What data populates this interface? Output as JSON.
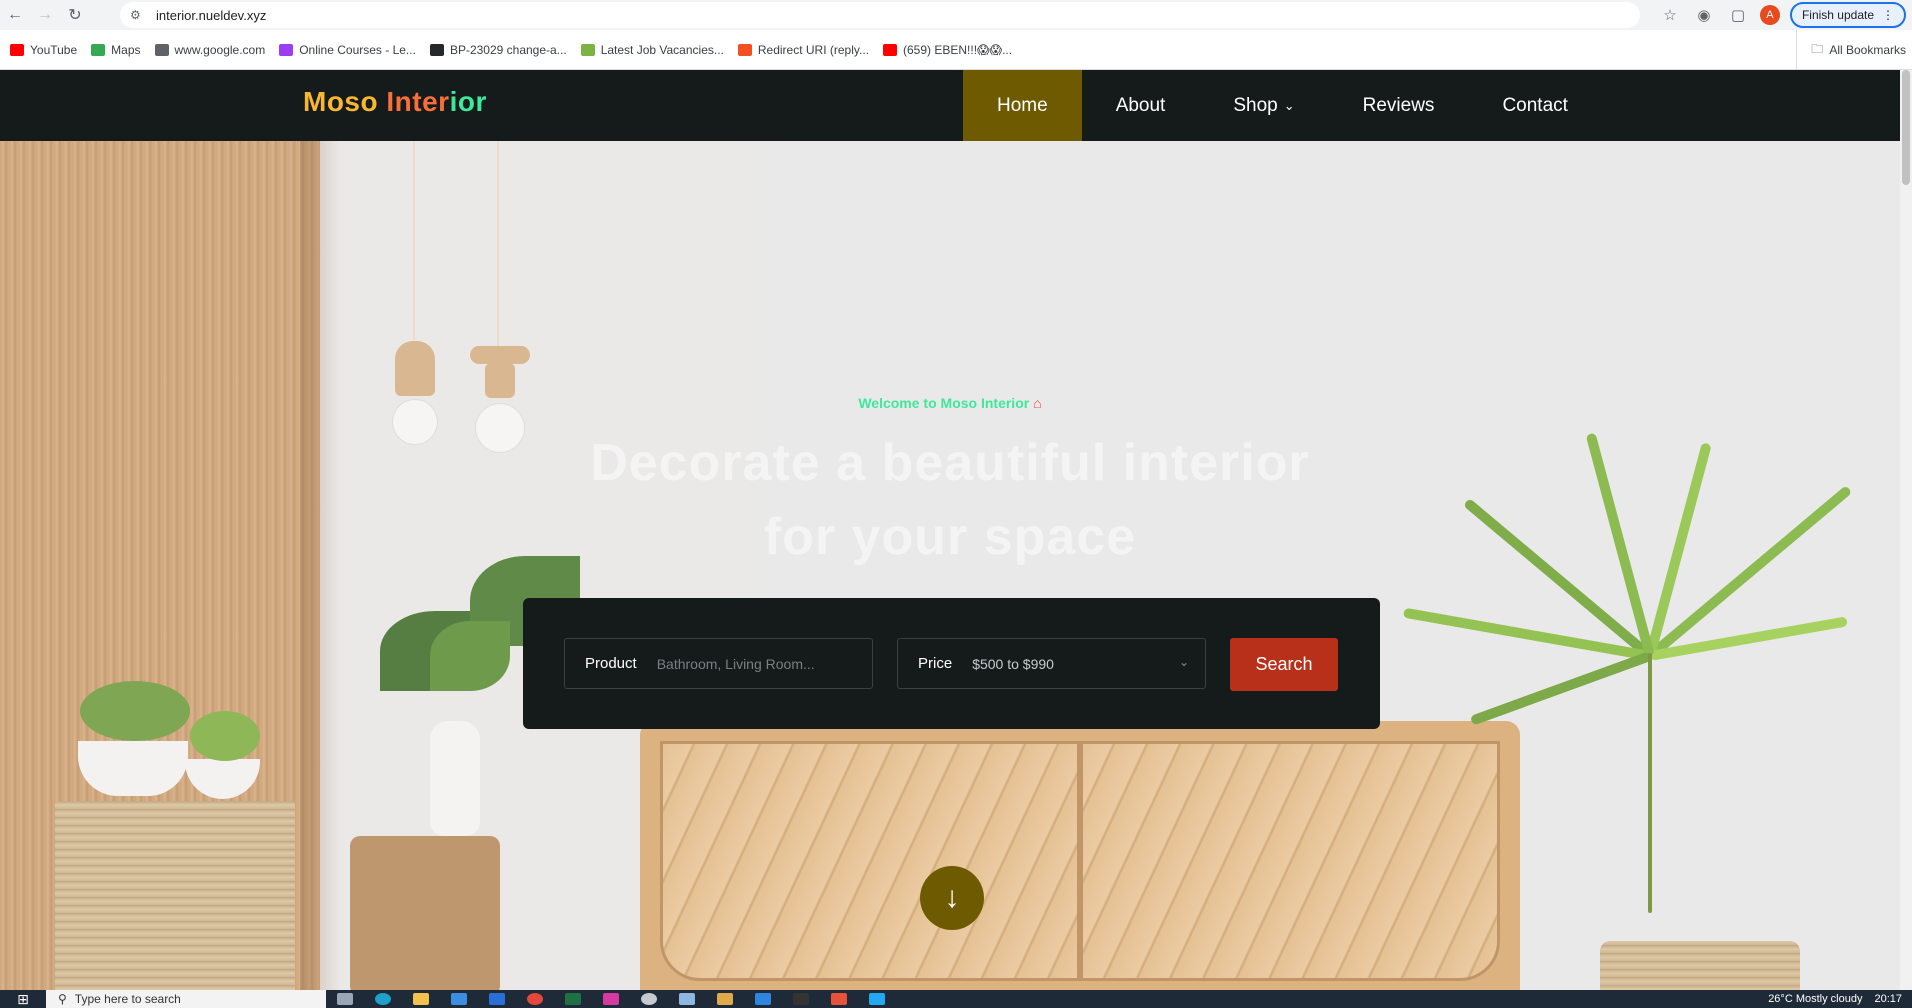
{
  "browser": {
    "url": "interior.nueldev.xyz",
    "finish_update_label": "Finish update",
    "avatar_letter": "A",
    "bookmarks": [
      {
        "label": "YouTube",
        "color": "#ff0000"
      },
      {
        "label": "Maps",
        "color": "#34a853"
      },
      {
        "label": "www.google.com",
        "color": "#5f6368"
      },
      {
        "label": "Online Courses - Le...",
        "color": "#9b3df0"
      },
      {
        "label": "BP-23029 change-a...",
        "color": "#24292e"
      },
      {
        "label": "Latest Job Vacancies...",
        "color": "#7cb342"
      },
      {
        "label": "Redirect URI (reply...",
        "color": "#f25022"
      },
      {
        "label": "(659) EBEN!!!😱😱...",
        "color": "#ff0000"
      }
    ],
    "all_bookmarks_label": "All Bookmarks"
  },
  "site": {
    "logo": {
      "word1": "Moso",
      "word2a": "Inter",
      "word2b": "ior"
    },
    "menu": [
      {
        "label": "Home",
        "active": true
      },
      {
        "label": "About",
        "active": false
      },
      {
        "label": "Shop",
        "active": false,
        "has_dropdown": true
      },
      {
        "label": "Reviews",
        "active": false
      },
      {
        "label": "Contact",
        "active": false
      }
    ],
    "hero": {
      "tagline": "Welcome to Moso Interior",
      "headline_line1": "Decorate a beautiful interior",
      "headline_line2": "for your space"
    },
    "search": {
      "product_label": "Product",
      "product_placeholder": "Bathroom, Living Room...",
      "price_label": "Price",
      "price_value": "$500 to $990",
      "button_label": "Search"
    },
    "colors": {
      "nav_bg": "#151a1b",
      "active_menu": "#6e5a00",
      "accent_green": "#3ee89a",
      "search_button": "#b8301a"
    }
  },
  "taskbar": {
    "search_placeholder": "Type here to search",
    "weather": "26°C  Mostly cloudy",
    "time": "20:17"
  }
}
